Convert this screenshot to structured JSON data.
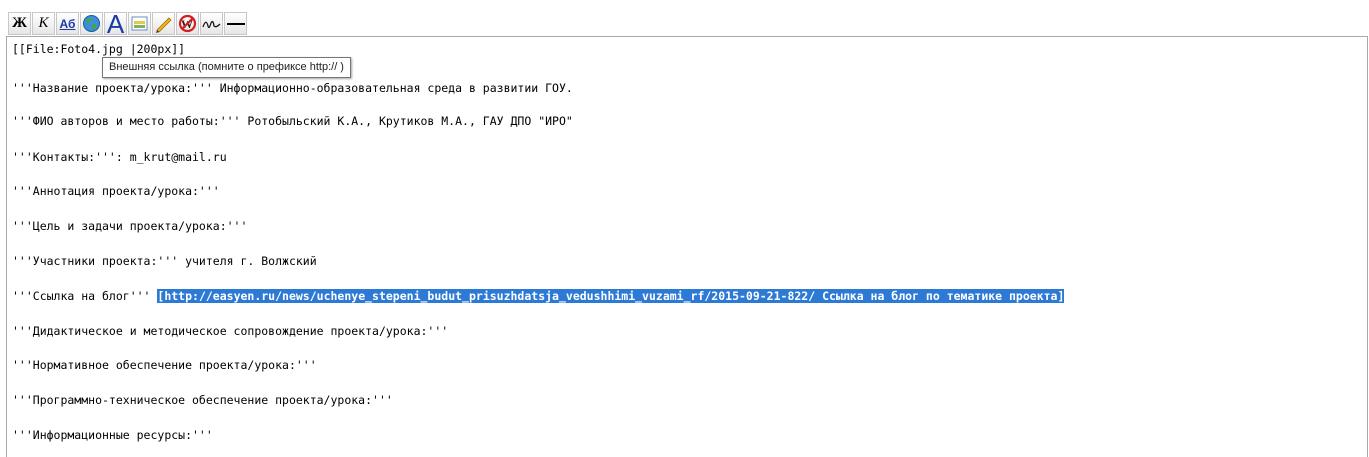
{
  "toolbar": {
    "bold_label": "Ж",
    "italic_label": "К",
    "link_label": "Аб",
    "big_label": "A",
    "buttons": [
      {
        "name": "bold-button",
        "icon": "bold-icon"
      },
      {
        "name": "italic-button",
        "icon": "italic-icon"
      },
      {
        "name": "internal-link-button",
        "icon": "internal-link-icon"
      },
      {
        "name": "external-link-button",
        "icon": "globe-icon"
      },
      {
        "name": "big-heading-button",
        "icon": "heading-icon"
      },
      {
        "name": "embedded-file-button",
        "icon": "image-icon"
      },
      {
        "name": "media-file-button",
        "icon": "pencil-icon"
      },
      {
        "name": "nowiki-button",
        "icon": "no-wiki-icon"
      },
      {
        "name": "signature-button",
        "icon": "signature-icon"
      },
      {
        "name": "horizontal-line-button",
        "icon": "horizontal-line-icon"
      }
    ]
  },
  "tooltip": {
    "text": "Внешняя ссылка (помните о префиксе http:// )"
  },
  "editor": {
    "line_file": "[[File:Foto4.jpg |200px]]",
    "line_project_name": "'''Название проекта/урока:''' Информационно-образовательная среда в развитии ГОУ.",
    "line_authors": "'''ФИО авторов и место работы:''' Ротобыльский К.А., Крутиков М.А., ГАУ ДПО \"ИРО\"",
    "line_contacts": "'''Контакты:''': m_krut@mail.ru",
    "line_annotation": "'''Аннотация проекта/урока:'''",
    "line_goals": "'''Цель и задачи проекта/урока:'''",
    "line_participants": "'''Участники проекта:''' учителя г. Волжский",
    "line_blog_prefix": "'''Ссылка на блог''' ",
    "line_blog_link": "[http://easyen.ru/news/uchenye_stepeni_budut_prisuzhdatsja_vedushhimi_vuzami_rf/2015-09-21-822/ Ссылка на блог по тематике проекта]",
    "line_didactic": "'''Дидактическое и методическое сопровождение проекта/урока:'''",
    "line_normative": "'''Нормативное обеспечение проекта/урока:'''",
    "line_software": "'''Программно-техническое обеспечение проекта/урока:'''",
    "line_resources": "'''Информационные ресурсы:'''"
  }
}
